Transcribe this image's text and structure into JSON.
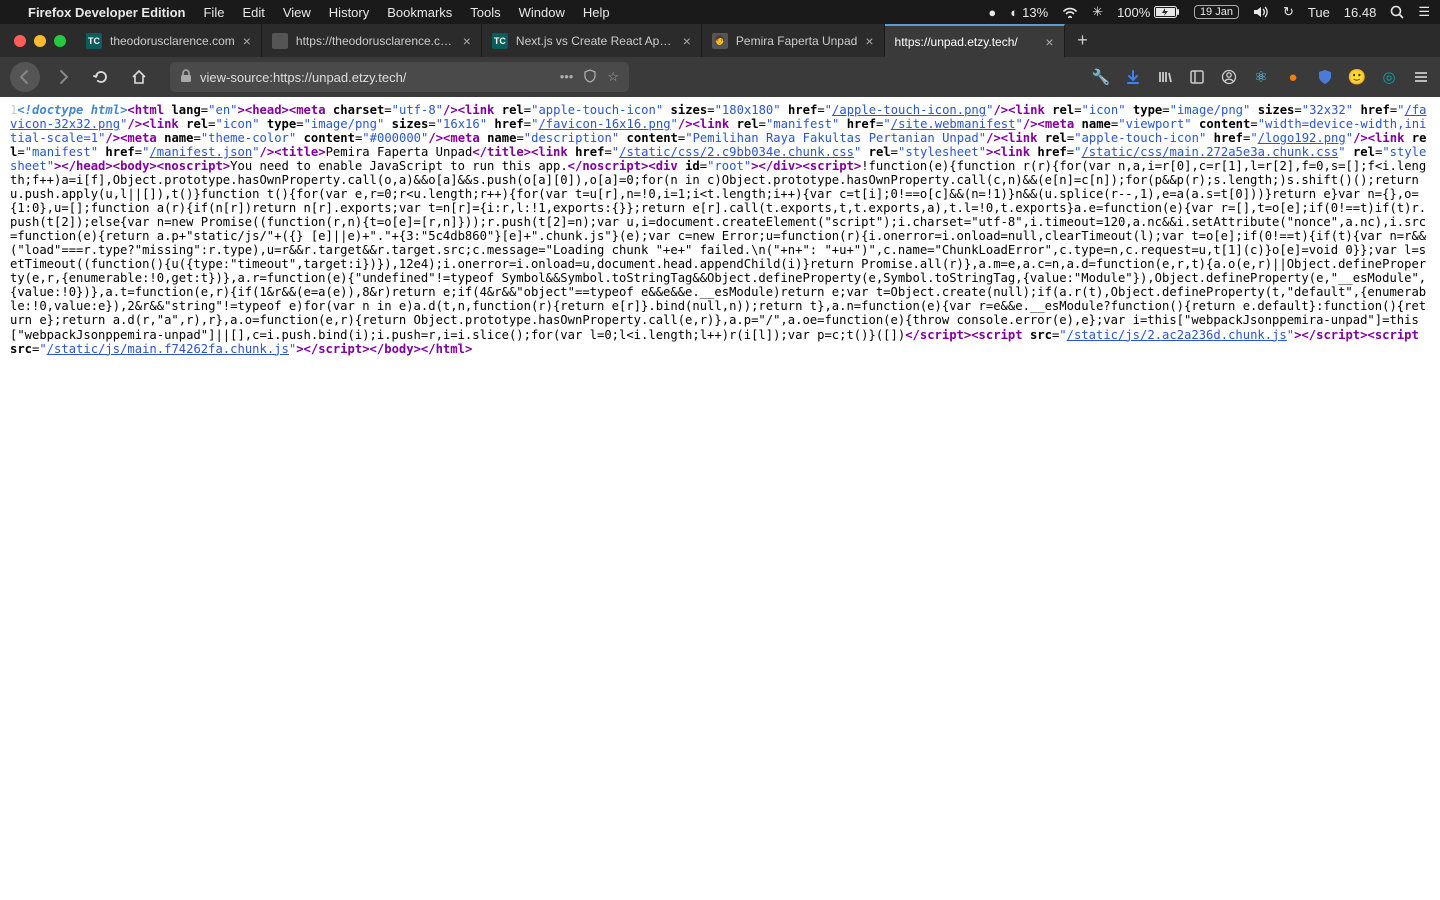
{
  "menubar": {
    "app_name": "Firefox Developer Edition",
    "items": [
      "File",
      "Edit",
      "View",
      "History",
      "Bookmarks",
      "Tools",
      "Window",
      "Help"
    ],
    "cpu_pct": "13%",
    "battery_pct": "100%",
    "date_pill": "19 Jan",
    "day": "Tue",
    "time": "16.48"
  },
  "tabs": [
    {
      "label": "theodorusclarence.com",
      "favicon": "TC",
      "active": false
    },
    {
      "label": "https://theodorusclarence.com/",
      "favicon": "",
      "active": false
    },
    {
      "label": "Next.js vs Create React App – t",
      "favicon": "TC",
      "active": false
    },
    {
      "label": "Pemira Faperta Unpad",
      "favicon": "🧑",
      "active": false
    },
    {
      "label": "https://unpad.etzy.tech/",
      "favicon": "",
      "active": true
    }
  ],
  "url": "view-source:https://unpad.etzy.tech/",
  "source": {
    "line_no": "1",
    "doctype": "<!doctype html>",
    "lang": "en",
    "charset": "utf-8",
    "apple_touch_icon": {
      "rel": "apple-touch-icon",
      "sizes": "180x180",
      "href": "/apple-touch-icon.png"
    },
    "favicon32": {
      "rel": "icon",
      "type": "image/png",
      "sizes": "32x32",
      "href": "/favicon-32x32.png"
    },
    "favicon16": {
      "rel": "icon",
      "type": "image/png",
      "sizes": "16x16",
      "href": "/favicon-16x16.png"
    },
    "manifest": {
      "rel": "manifest",
      "href": "/site.webmanifest"
    },
    "viewport": {
      "name": "viewport",
      "content": "width=device-width,initial-scale=1"
    },
    "theme_color": {
      "name": "theme-color",
      "content": "#000000"
    },
    "description": {
      "name": "description",
      "content": "Pemilihan Raya Fakultas Pertanian Unpad"
    },
    "logo192": {
      "rel": "apple-touch-icon",
      "href": "/logo192.png"
    },
    "manifest_json": {
      "rel": "manifest",
      "href": "/manifest.json"
    },
    "title": "Pemira Faperta Unpad",
    "css1": {
      "href": "/static/css/2.c9bb034e.chunk.css",
      "rel": "stylesheet"
    },
    "css2": {
      "href": "/static/css/main.272a5e3a.chunk.css",
      "rel": "stylesheet"
    },
    "noscript": "You need to enable JavaScript to run this app.",
    "root_id": "root",
    "bootstrap_js": "!function(e){function r(r){for(var n,a,i=r[0],c=r[1],l=r[2],f=0,s=[];f<i.length;f++)a=i[f],Object.prototype.hasOwnProperty.call(o,a)&&o[a]&&s.push(o[a][0]),o[a]=0;for(n in c)Object.prototype.hasOwnProperty.call(c,n)&&(e[n]=c[n]);for(p&&p(r);s.length;)s.shift()();return u.push.apply(u,l||[]),t()}function t(){for(var e,r=0;r<u.length;r++){for(var t=u[r],n=!0,i=1;i<t.length;i++){var c=t[i];0!==o[c]&&(n=!1)}n&&(u.splice(r--,1),e=a(a.s=t[0]))}return e}var n={},o={1:0},u=[];function a(r){if(n[r])return n[r].exports;var t=n[r]={i:r,l:!1,exports:{}};return e[r].call(t.exports,t,t.exports,a),t.l=!0,t.exports}a.e=function(e){var r=[],t=o[e];if(0!==t)if(t)r.push(t[2]);else{var n=new Promise((function(r,n){t=o[e]=[r,n]}));r.push(t[2]=n);var u,i=document.createElement(\"script\");i.charset=\"utf-8\",i.timeout=120,a.nc&&i.setAttribute(\"nonce\",a.nc),i.src=function(e){return a.p+\"static/js/\"+({} [e]||e)+\".\"+{3:\"5c4db860\"}[e]+\".chunk.js\"}(e);var c=new Error;u=function(r){i.onerror=i.onload=null,clearTimeout(l);var t=o[e];if(0!==t){if(t){var n=r&&(\"load\"===r.type?\"missing\":r.type),u=r&&r.target&&r.target.src;c.message=\"Loading chunk \"+e+\" failed.\\n(\"+n+\": \"+u+\")\",c.name=\"ChunkLoadError\",c.type=n,c.request=u,t[1](c)}o[e]=void 0}};var l=setTimeout((function(){u({type:\"timeout\",target:i})}),12e4);i.onerror=i.onload=u,document.head.appendChild(i)}return Promise.all(r)},a.m=e,a.c=n,a.d=function(e,r,t){a.o(e,r)||Object.defineProperty(e,r,{enumerable:!0,get:t})},a.r=function(e){\"undefined\"!=typeof Symbol&&Symbol.toStringTag&&Object.defineProperty(e,Symbol.toStringTag,{value:\"Module\"}),Object.defineProperty(e,\"__esModule\",{value:!0})},a.t=function(e,r){if(1&r&&(e=a(e)),8&r)return e;if(4&r&&\"object\"==typeof e&&e&&e.__esModule)return e;var t=Object.create(null);if(a.r(t),Object.defineProperty(t,\"default\",{enumerable:!0,value:e}),2&r&&\"string\"!=typeof e)for(var n in e)a.d(t,n,function(r){return e[r]}.bind(null,n));return t},a.n=function(e){var r=e&&e.__esModule?function(){return e.default}:function(){return e};return a.d(r,\"a\",r),r},a.o=function(e,r){return Object.prototype.hasOwnProperty.call(e,r)},a.p=\"/\",a.oe=function(e){throw console.error(e),e};var i=this[\"webpackJsonppemira-unpad\"]=this[\"webpackJsonppemira-unpad\"]||[],c=i.push.bind(i);i.push=r,i=i.slice();for(var l=0;l<i.length;l++)r(i[l]);var p=c;t()}([])",
    "script1_src": "/static/js/2.ac2a236d.chunk.js",
    "script2_src": "/static/js/main.f74262fa.chunk.js"
  }
}
